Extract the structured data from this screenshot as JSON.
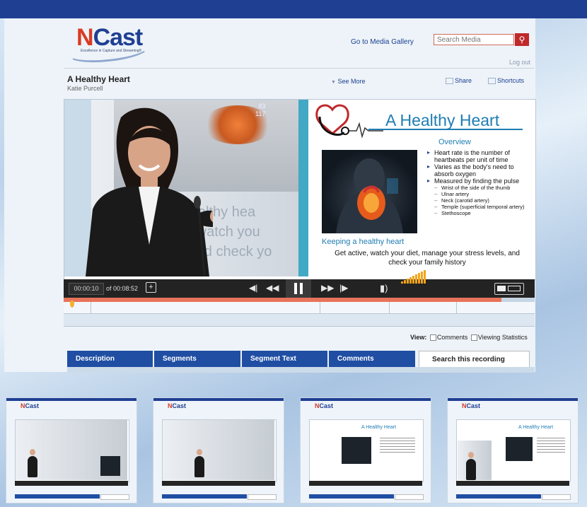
{
  "header": {
    "logo_text_accent": "N",
    "logo_text_rest": "Cast",
    "logo_tagline": "Excellence in Capture and Streaming®",
    "gallery_link": "Go to Media Gallery",
    "search_placeholder": "Search Media",
    "search_icon": "search-icon",
    "logout": "Log out"
  },
  "recording": {
    "title": "A Healthy Heart",
    "author": "Katie Purcell",
    "see_more": "See More",
    "share": "Share",
    "shortcuts": "Shortcuts"
  },
  "video": {
    "monitor_numbers": [
      "83",
      "117"
    ],
    "ghost_line1": "a healthy hea",
    "ghost_line2": "ive, watch you",
    "ghost_line3": "ls, and check yo"
  },
  "slide": {
    "title": "A Healthy Heart",
    "overview_heading": "Overview",
    "bullets": [
      "Heart rate is the number of heartbeats per unit of time",
      "Varies as the body's need to absorb oxygen",
      "Measured by finding the pulse"
    ],
    "sub_bullets": [
      "Wrist of the side of the thumb",
      "Ulnar artery",
      "Neck (carotid artery)",
      "Temple (superficial temporal artery)",
      "Stethoscope"
    ],
    "keeping_heading": "Keeping a healthy heart",
    "keeping_text": "Get active, watch your diet, manage your stress levels, and check your family history"
  },
  "player": {
    "current_time": "00:00:10",
    "duration": "of 00:08:52",
    "progress_fraction": 0.93,
    "icons": [
      "add-bookmark-icon",
      "skip-start-icon",
      "rewind-icon",
      "pause-icon",
      "fast-forward-icon",
      "skip-end-icon",
      "volume-icon",
      "layout-icon"
    ]
  },
  "view_options": {
    "label": "View:",
    "comments": "Comments",
    "viewing_statistics": "Viewing Statistics"
  },
  "tabs": [
    "Description",
    "Segments",
    "Segment Text",
    "Comments",
    "Search this recording"
  ],
  "colors": {
    "brand_blue": "#1f3f93",
    "accent_red": "#c0282a",
    "slide_blue": "#1f7db3",
    "volume_orange": "#f2a51b"
  }
}
